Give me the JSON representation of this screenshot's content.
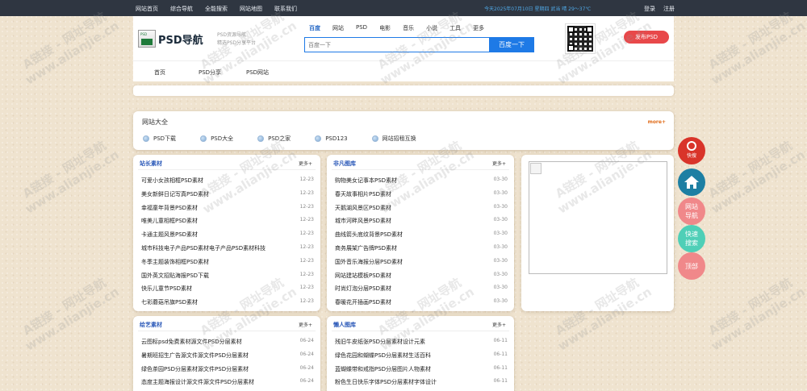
{
  "topbar": {
    "links": [
      "网站首页",
      "综合导航",
      "全能搜索",
      "网站地图",
      "联系我们"
    ],
    "date_text": "今天2025年07月10日 星期四 武当 晴 29～37℃",
    "login": "登录",
    "register": "注册"
  },
  "header": {
    "logo_text": "PSD导航",
    "slogan": "PSD资源导航\n精选PSD分享平台",
    "search_tabs": [
      "百度",
      "网站",
      "PSD",
      "电影",
      "音乐",
      "小说",
      "工具",
      "更多"
    ],
    "search_placeholder": "百度一下",
    "search_button": "百度一下",
    "publish_button": "发布PSD"
  },
  "subnav": [
    "首页",
    "PSD分享",
    "PSD网站"
  ],
  "sites": {
    "title": "网站大全",
    "more": "more+",
    "items": [
      "PSD下载",
      "PSD大全",
      "PSD之家",
      "PSD123",
      "网站招租互换"
    ]
  },
  "panels": [
    {
      "title": "站长素材",
      "more": "更多+",
      "items": [
        {
          "t": "可爱小女孩相框PSD素材",
          "d": "12-23"
        },
        {
          "t": "美女新鲜日记写真PSD素材",
          "d": "12-23"
        },
        {
          "t": "幸福童年背景PSD素材",
          "d": "12-23"
        },
        {
          "t": "唯美儿童相框PSD素材",
          "d": "12-23"
        },
        {
          "t": "卡通主题风景PSD素材",
          "d": "12-23"
        },
        {
          "t": "城市科技电子产品PSD素材电子产品PSD素材科技",
          "d": "12-23"
        },
        {
          "t": "冬季主题装饰相框PSD素材",
          "d": "12-23"
        },
        {
          "t": "国外英文招贴海报PSD下载",
          "d": "12-23"
        },
        {
          "t": "快乐儿童节PSD素材",
          "d": "12-23"
        },
        {
          "t": "七彩蘑菇吊旗PSD素材",
          "d": "12-23"
        }
      ]
    },
    {
      "title": "非凡图库",
      "more": "更多+",
      "items": [
        {
          "t": "购物美女记事本PSD素材",
          "d": "03-30"
        },
        {
          "t": "春天故事相片PSD素材",
          "d": "03-30"
        },
        {
          "t": "天鹅湖风景区PSD素材",
          "d": "03-30"
        },
        {
          "t": "城市河畔风景PSD素材",
          "d": "03-30"
        },
        {
          "t": "曲线箭头底纹背景PSD素材",
          "d": "03-30"
        },
        {
          "t": "商务展架广告牌PSD素材",
          "d": "03-30"
        },
        {
          "t": "国外音乐海报分层PSD素材",
          "d": "03-30"
        },
        {
          "t": "网站建站模板PSD素材",
          "d": "03-30"
        },
        {
          "t": "时尚灯泡分层PSD素材",
          "d": "03-30"
        },
        {
          "t": "春暖花开插画PSD素材",
          "d": "03-30"
        }
      ]
    },
    {
      "title": "绘艺素材",
      "more": "更多+",
      "items": [
        {
          "t": "云图标psd免费素材源文件PSD分层素材",
          "d": "06-24"
        },
        {
          "t": "暑期班招生广告源文件源文件PSD分层素材",
          "d": "06-24"
        },
        {
          "t": "绿色茶园PSD分层素材源文件PSD分层素材",
          "d": "06-24"
        },
        {
          "t": "态度主题海报设计源文件源文件PSD分层素材",
          "d": "06-24"
        }
      ]
    },
    {
      "title": "懒人图库",
      "more": "更多+",
      "items": [
        {
          "t": "残旧牛皮纸张PSD分层素材设计元素",
          "d": "06-11"
        },
        {
          "t": "绿色花园和蝴蝶PSD分层素材生活百科",
          "d": "06-11"
        },
        {
          "t": "蓝蝴蝶带和戒指PSD分层图片人物素材",
          "d": "06-11"
        },
        {
          "t": "粉色生日快乐字体PSD分层素材字体设计",
          "d": "06-11"
        }
      ]
    }
  ],
  "float_buttons": [
    {
      "label": "快搜",
      "color": "#d9342a"
    },
    {
      "label": "",
      "color": "#1d7fa3"
    },
    {
      "label": "网站\n导航",
      "color": "#f0888a"
    },
    {
      "label": "快速\n搜索",
      "color": "#4fcfb7"
    },
    {
      "label": "顶部",
      "color": "#f0888a"
    }
  ],
  "watermark": {
    "line1": "A链接 - 网址导航",
    "line2": "www.alianjie.cn"
  }
}
